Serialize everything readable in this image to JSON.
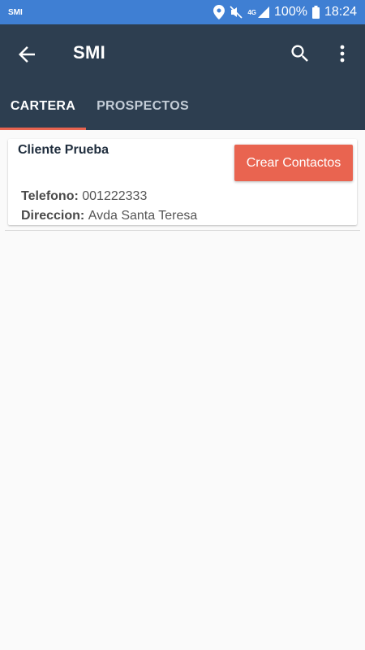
{
  "status_bar": {
    "left_label": "SMI",
    "network": "4G",
    "battery": "100%",
    "time": "18:24"
  },
  "app_bar": {
    "title": "SMI",
    "icons": [
      "back-arrow-icon",
      "search-icon",
      "more-vert-icon"
    ]
  },
  "tabs": [
    {
      "label": "CARTERA",
      "active": true
    },
    {
      "label": "PROSPECTOS",
      "active": false
    }
  ],
  "colors": {
    "status_bar": "#3f7fd3",
    "app_bar": "#2d3e50",
    "accent": "#e96450"
  },
  "card": {
    "client_name": "Cliente Prueba",
    "button_label": "Crear Contactos",
    "telefono_label": "Telefono:",
    "telefono_value": "001222333",
    "direccion_label": "Direccion:",
    "direccion_value": "Avda Santa Teresa"
  }
}
